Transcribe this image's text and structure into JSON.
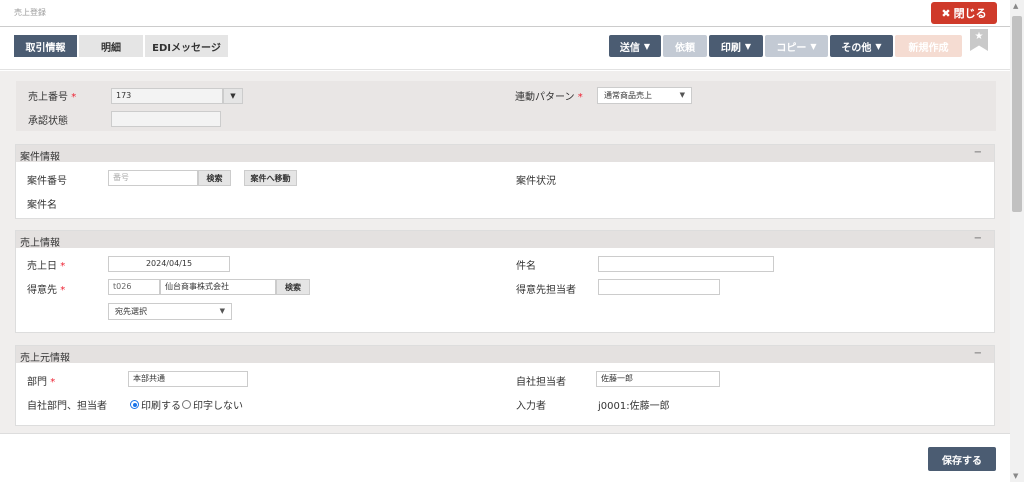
{
  "window": {
    "title": "売上登録",
    "close_label": "閉じる",
    "close_icon": "✖"
  },
  "tabs": [
    {
      "label": "取引情報",
      "active": true
    },
    {
      "label": "明細",
      "active": false
    },
    {
      "label": "EDIメッセージ",
      "active": false
    }
  ],
  "toolbar": {
    "send": "送信",
    "request": "依頼",
    "print": "印刷",
    "copy": "コピー",
    "other": "その他",
    "new": "新規作成",
    "caret": "▼",
    "bookmark": "★"
  },
  "header": {
    "sales_no_label": "売上番号",
    "sales_no_value": "173",
    "approval_label": "承認状態",
    "approval_value": "",
    "pattern_label": "連動パターン",
    "pattern_value": "通常商品売上",
    "required_mark": "*",
    "dropdown_arrow": "▼"
  },
  "case_info": {
    "title": "案件情報",
    "collapse": "−",
    "case_no_label": "案件番号",
    "case_no_placeholder": "番号",
    "search_label": "検索",
    "goto_case_label": "案件へ移動",
    "case_status_label": "案件状況",
    "case_name_label": "案件名"
  },
  "sales_info": {
    "title": "売上情報",
    "collapse": "−",
    "date_label": "売上日",
    "date_value": "2024/04/15",
    "customer_label": "得意先",
    "customer_code": "t026",
    "customer_name": "仙台商事株式会社",
    "search_label": "検索",
    "dest_select": "宛先選択",
    "subject_label": "件名",
    "subject_value": "",
    "contact_label": "得意先担当者",
    "contact_value": ""
  },
  "source_info": {
    "title": "売上元情報",
    "collapse": "−",
    "dept_label": "部門",
    "dept_value": "本部共通",
    "staff_label": "自社担当者",
    "staff_value": "佐藤一郎",
    "print_label": "自社部門、担当者",
    "print_on": "印刷する",
    "print_off": "印字しない",
    "entry_label": "入力者",
    "entry_value": "j0001:佐藤一郎"
  },
  "footer": {
    "save_label": "保存する"
  },
  "scroll": {
    "up": "▲",
    "down": "▼"
  },
  "colors": {
    "primary": "#4b5c72",
    "danger": "#cf3a2a",
    "disabled": "#c3cad4",
    "pale": "#f5dcd2"
  }
}
